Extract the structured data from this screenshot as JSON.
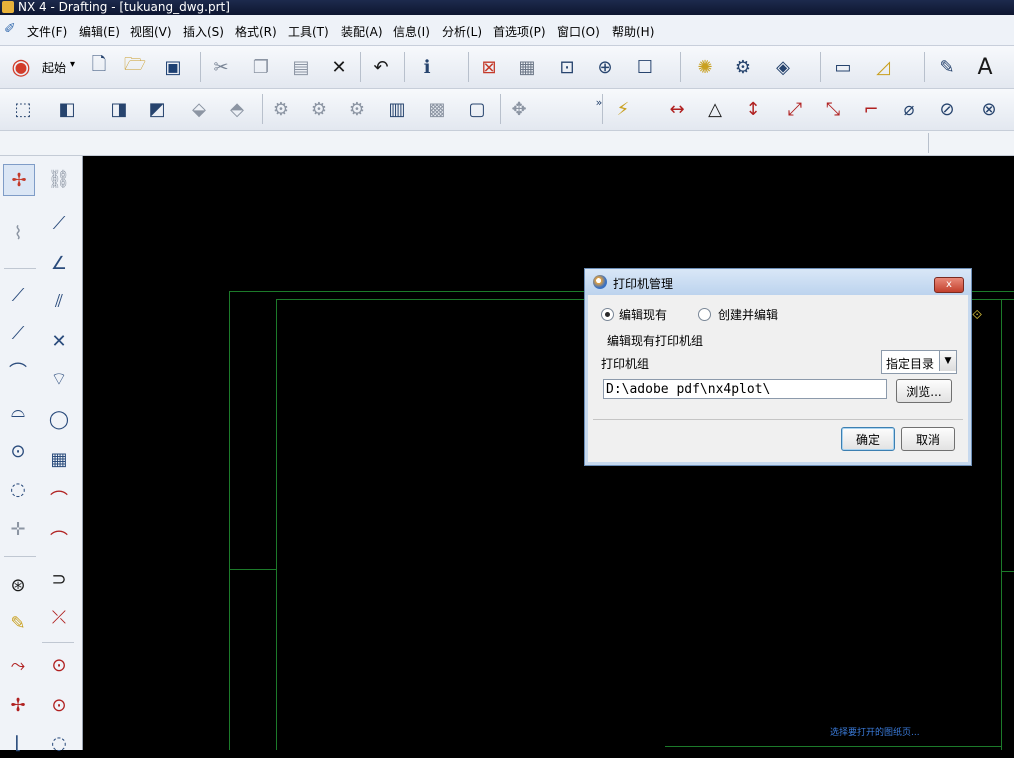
{
  "window": {
    "title": "NX 4 - Drafting - [tukuang_dwg.prt]"
  },
  "menu": [
    "文件(F)",
    "编辑(E)",
    "视图(V)",
    "插入(S)",
    "格式(R)",
    "工具(T)",
    "装配(A)",
    "信息(I)",
    "分析(L)",
    "首选项(P)",
    "窗口(O)",
    "帮助(H)"
  ],
  "toolbar": {
    "start_label": "起始",
    "start_arrow": "▾"
  },
  "icons": {
    "new": "new-file-icon",
    "open": "open-folder-icon",
    "save": "save-icon",
    "cut": "cut-icon",
    "copy": "copy-icon",
    "paste": "paste-icon",
    "delete": "delete-icon",
    "undo": "undo-icon"
  },
  "dialog": {
    "title": "打印机管理",
    "close_label": "x",
    "radio_edit": "编辑现有",
    "radio_create": "创建并编辑",
    "section_label": "编辑现有打印机组",
    "group_label": "打印机组",
    "dir_select": "指定目录",
    "path_value": "D:\\adobe pdf\\nx4plot\\",
    "browse_label": "浏览...",
    "ok_label": "确定",
    "cancel_label": "取消"
  },
  "status": {
    "text": "选择要打开的图纸页..."
  }
}
